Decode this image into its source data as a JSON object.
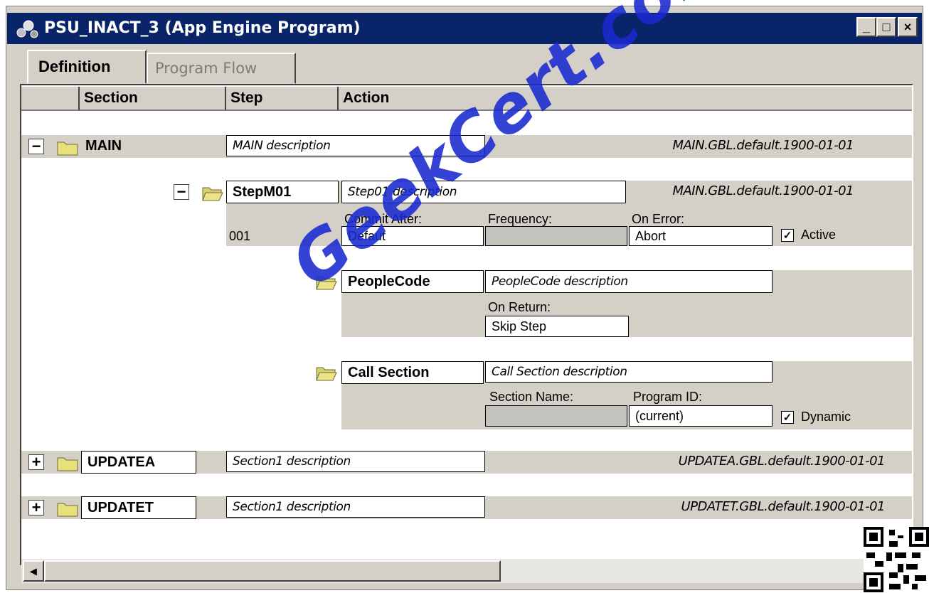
{
  "window": {
    "title": "PSU_INACT_3 (App Engine Program)"
  },
  "tabs": [
    {
      "label": "Definition"
    },
    {
      "label": "Program Flow"
    }
  ],
  "columns": [
    {
      "label": "Section"
    },
    {
      "label": "Step"
    },
    {
      "label": "Action"
    }
  ],
  "sections": {
    "main": {
      "name": "MAIN",
      "description": "MAIN description",
      "stamp": "MAIN.GBL.default.1900-01-01",
      "expander": "−"
    },
    "updatea": {
      "name": "UPDATEA",
      "description": "Section1 description",
      "stamp": "UPDATEA.GBL.default.1900-01-01",
      "expander": "+"
    },
    "updatet": {
      "name": "UPDATET",
      "description": "Section1 description",
      "stamp": "UPDATET.GBL.default.1900-01-01",
      "expander": "+"
    }
  },
  "step": {
    "name": "StepM01",
    "description": "Step01 description",
    "stamp": "MAIN.GBL.default.1900-01-01",
    "expander": "−",
    "number": "001",
    "commit_label": "Commit After:",
    "commit_value": "Defaut",
    "frequency_label": "Frequency:",
    "frequency_value": "",
    "onerror_label": "On Error:",
    "onerror_value": "Abort",
    "active_label": "Active",
    "active_checked": true
  },
  "actions": {
    "peoplecode": {
      "name": "PeopleCode",
      "description": "PeopleCode description",
      "onreturn_label": "On Return:",
      "onreturn_value": "Skip Step"
    },
    "callsection": {
      "name": "Call Section",
      "description": "Call Section description",
      "sectionname_label": "Section Name:",
      "sectionname_value": "",
      "programid_label": "Program ID:",
      "programid_value": "(current)",
      "dynamic_label": "Dynamic",
      "dynamic_checked": true
    }
  },
  "watermark": "GeekCert.com",
  "glyphs": {
    "check": "✓",
    "minimize": "_",
    "maximize": "□",
    "close": "×",
    "scroll_left": "◂"
  },
  "colors": {
    "titlebar": "#0a246a",
    "face": "#d4d0c8",
    "watermark": "#1a2ad0"
  }
}
